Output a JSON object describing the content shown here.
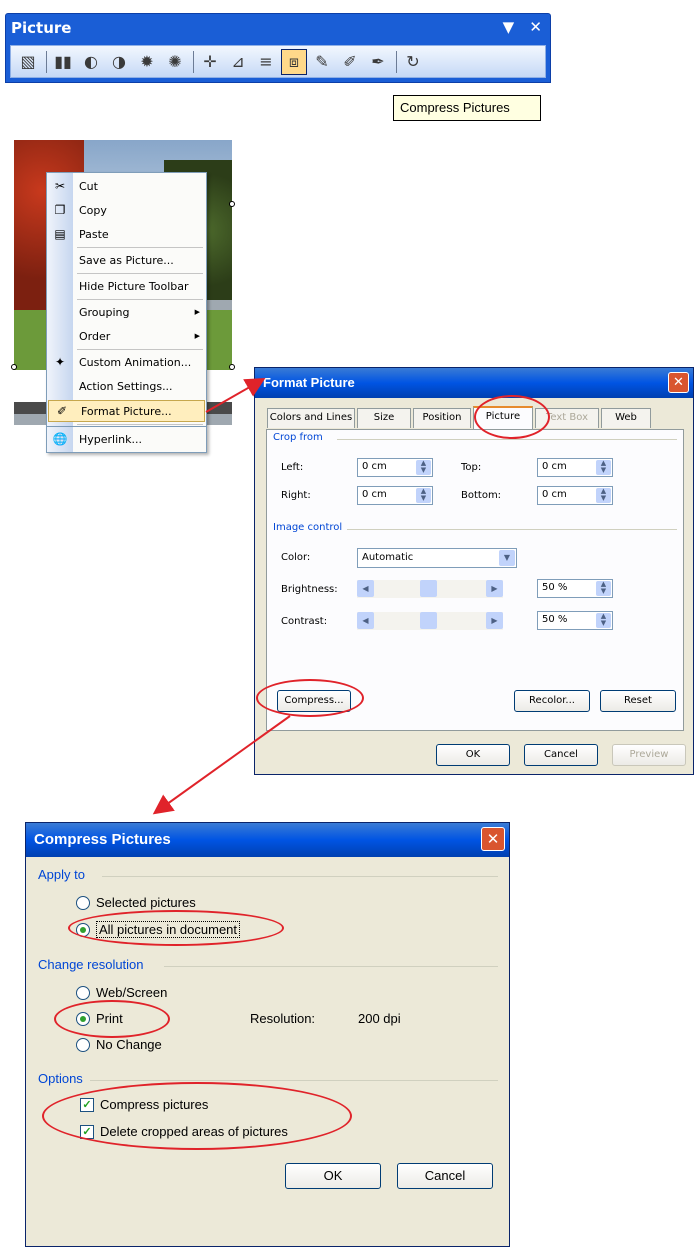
{
  "toolbar": {
    "title": "Picture",
    "dropdown_glyph": "▼",
    "close_glyph": "✕",
    "buttons": [
      {
        "name": "insert-picture-icon",
        "glyph": "▧"
      },
      {
        "name": "color-icon",
        "glyph": "▮▮"
      },
      {
        "name": "more-contrast-icon",
        "glyph": "◐"
      },
      {
        "name": "less-contrast-icon",
        "glyph": "◑"
      },
      {
        "name": "more-brightness-icon",
        "glyph": "✹"
      },
      {
        "name": "less-brightness-icon",
        "glyph": "✺"
      },
      {
        "name": "crop-icon",
        "glyph": "✛"
      },
      {
        "name": "rotate-left-icon",
        "glyph": "⊿"
      },
      {
        "name": "line-style-icon",
        "glyph": "≡"
      },
      {
        "name": "compress-pictures-icon",
        "glyph": "⧈"
      },
      {
        "name": "recolor-picture-icon",
        "glyph": "✎"
      },
      {
        "name": "format-picture-icon",
        "glyph": "✐"
      },
      {
        "name": "set-transparent-color-icon",
        "glyph": "✒"
      },
      {
        "name": "reset-picture-icon",
        "glyph": "↻"
      }
    ],
    "tooltip": "Compress Pictures",
    "accent": "#1a5ed6"
  },
  "context_menu": {
    "items": [
      {
        "label": "Cut",
        "icon": "scissors-icon",
        "glyph": "✂"
      },
      {
        "label": "Copy",
        "icon": "copy-icon",
        "glyph": "❐"
      },
      {
        "label": "Paste",
        "icon": "paste-icon",
        "glyph": "▤"
      },
      {
        "label": "Save as Picture...",
        "icon": "",
        "glyph": ""
      },
      {
        "label": "Hide Picture Toolbar",
        "icon": "",
        "glyph": ""
      },
      {
        "label": "Grouping",
        "icon": "",
        "glyph": "",
        "submenu": true
      },
      {
        "label": "Order",
        "icon": "",
        "glyph": "",
        "submenu": true
      },
      {
        "label": "Custom Animation...",
        "icon": "custom-animation-icon",
        "glyph": "✦"
      },
      {
        "label": "Action Settings...",
        "icon": "",
        "glyph": ""
      },
      {
        "label": "Format Picture...",
        "icon": "format-picture-icon",
        "glyph": "✐",
        "highlighted": true
      },
      {
        "label": "Hyperlink...",
        "icon": "hyperlink-icon",
        "glyph": "🌐"
      }
    ],
    "submenu_arrow": "▶"
  },
  "format_picture": {
    "title": "Format Picture",
    "close_glyph": "✕",
    "tabs": [
      "Colors and Lines",
      "Size",
      "Position",
      "Picture",
      "Text Box",
      "Web"
    ],
    "active_tab": "Picture",
    "crop_group": "Crop from",
    "left_label": "Left:",
    "left_value": "0 cm",
    "top_label": "Top:",
    "top_value": "0 cm",
    "right_label": "Right:",
    "right_value": "0 cm",
    "bottom_label": "Bottom:",
    "bottom_value": "0 cm",
    "image_group": "Image control",
    "color_label": "Color:",
    "color_value": "Automatic",
    "brightness_label": "Brightness:",
    "brightness_value": "50 %",
    "contrast_label": "Contrast:",
    "contrast_value": "50 %",
    "compress_button": "Compress...",
    "recolor_button": "Recolor...",
    "reset_button": "Reset",
    "ok_button": "OK",
    "cancel_button": "Cancel",
    "preview_button": "Preview",
    "spin_up": "▲",
    "spin_down": "▼",
    "arrow_left": "◀",
    "arrow_right": "▶"
  },
  "compress_pictures": {
    "title": "Compress Pictures",
    "close_glyph": "✕",
    "apply_group": "Apply to",
    "selected_pictures": "Selected pictures",
    "all_pictures": "All pictures in document",
    "resolution_group": "Change resolution",
    "web_screen": "Web/Screen",
    "print": "Print",
    "no_change": "No Change",
    "resolution_label": "Resolution:",
    "resolution_value": "200 dpi",
    "options_group": "Options",
    "compress_pictures_option": "Compress pictures",
    "delete_cropped_option": "Delete cropped areas of pictures",
    "check_glyph": "✓",
    "ok_button": "OK",
    "cancel_button": "Cancel"
  },
  "annotation_color": "#e0232a"
}
